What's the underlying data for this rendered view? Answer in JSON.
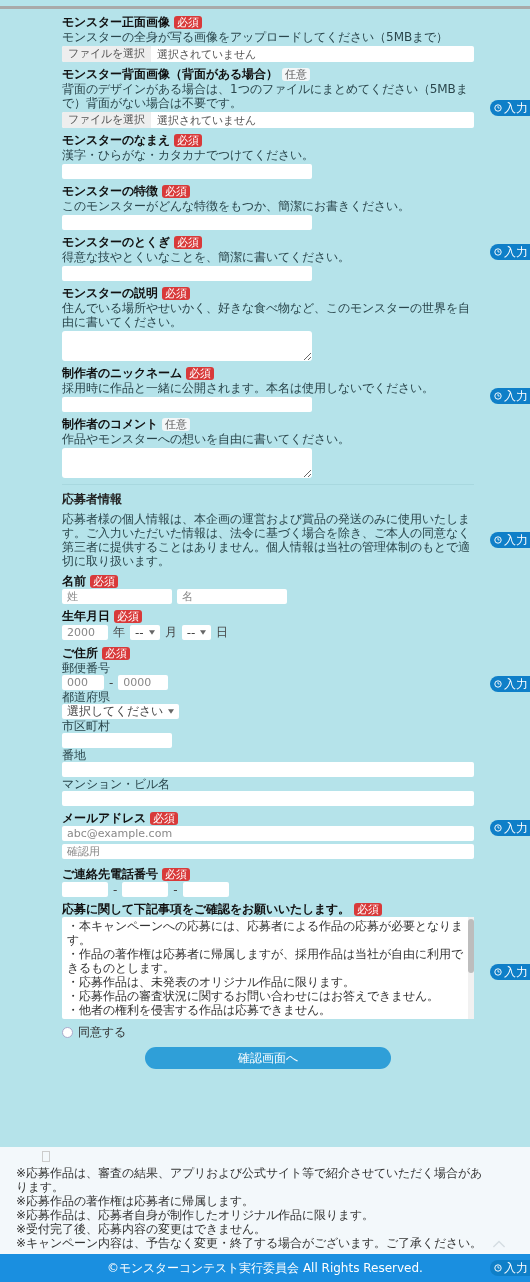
{
  "form_fields": [
    {
      "kind": "file",
      "label": "モンスター正面画像",
      "badge": "必須",
      "required": true,
      "hint": "モンスターの全身が写る画像をアップロードしてください（5MBまで）",
      "button": "ファイルを選択",
      "status": "選択されていません"
    },
    {
      "kind": "file",
      "label": "モンスター背面画像（背面がある場合）",
      "badge": "任意",
      "required": false,
      "hint": "背面のデザインがある場合は、1つのファイルにまとめてください（5MBまで）背面がない場合は不要です。",
      "button": "ファイルを選択",
      "status": "選択されていません"
    },
    {
      "kind": "text",
      "label": "モンスターのなまえ",
      "badge": "必須",
      "required": true,
      "hint": "漢字・ひらがな・カタカナでつけてください。"
    },
    {
      "kind": "text",
      "label": "モンスターの特徴",
      "badge": "必須",
      "required": true,
      "hint": "このモンスターがどんな特徴をもつか、簡潔にお書きください。"
    },
    {
      "kind": "text",
      "label": "モンスターのとくぎ",
      "badge": "必須",
      "required": true,
      "hint": "得意な技やとくいなことを、簡潔に書いてください。"
    },
    {
      "kind": "textarea",
      "label": "モンスターの説明",
      "badge": "必須",
      "required": true,
      "hint": "住んでいる場所やせいかく、好きな食べ物など、このモンスターの世界を自由に書いてください。"
    },
    {
      "kind": "text",
      "label": "制作者のニックネーム",
      "badge": "必須",
      "required": true,
      "hint": "採用時に作品と一緒に公開されます。本名は使用しないでください。"
    },
    {
      "kind": "textarea",
      "label": "制作者のコメント",
      "badge": "任意",
      "required": false,
      "hint": "作品やモンスターへの想いを自由に書いてください。"
    }
  ],
  "applicant": {
    "heading": "応募者情報",
    "text": "応募者様の個人情報は、本企画の運営および賞品の発送のみに使用いたします。ご入力いただいた情報は、法令に基づく場合を除き、ご本人の同意なく第三者に提供することはありません。個人情報は当社の管理体制のもとで適切に取り扱います。"
  },
  "applicant_fields": [
    {
      "kind": "name",
      "label": "名前",
      "badge": "必須",
      "required": true,
      "placeholders": [
        "姓",
        "名"
      ]
    },
    {
      "kind": "date",
      "label": "生年月日",
      "badge": "必須",
      "required": true,
      "year_placeholder": "2000",
      "year_unit": "年",
      "month": "--",
      "month_unit": "月",
      "day": "--",
      "day_unit": "日"
    },
    {
      "kind": "address",
      "label": "ご住所",
      "badge": "必須",
      "required": true,
      "parts": [
        {
          "kind": "zip",
          "label": "郵便番号",
          "placeholders": [
            "000",
            "0000"
          ],
          "separator": "-"
        },
        {
          "kind": "select",
          "label": "都道府県",
          "value": "選択してください"
        },
        {
          "kind": "short",
          "label": "市区町村"
        },
        {
          "kind": "long",
          "label": "番地"
        },
        {
          "kind": "long",
          "label": "マンション・ビル名"
        }
      ]
    },
    {
      "kind": "email",
      "label": "メールアドレス",
      "badge": "必須",
      "required": true,
      "placeholders": [
        "abc@example.com",
        "確認用"
      ]
    },
    {
      "kind": "phone",
      "label": "ご連絡先電話番号",
      "badge": "必須",
      "required": true,
      "separator": "-"
    },
    {
      "kind": "terms",
      "label": "応募に関して下記事項をご確認をお願いいたします。",
      "badge": "必須",
      "required": true,
      "lines": [
        "・本キャンペーンへの応募には、応募者による作品の応募が必要となります。",
        "・作品の著作権は応募者に帰属しますが、採用作品は当社が自由に利用できるものとします。",
        "・応募作品は、未発表のオリジナル作品に限ります。",
        "・応募作品の審査状況に関するお問い合わせにはお答えできません。",
        "・他者の権利を侵害する作品は応募できません。"
      ]
    }
  ],
  "agree": {
    "label": "同意する",
    "checked": false
  },
  "submit": "確認画面へ",
  "footer_notes": [
    "※応募作品は、審査の結果、アプリおよび公式サイト等で紹介させていただく場合があります。",
    "※応募作品の著作権は応募者に帰属します。",
    "※応募作品は、応募者自身が制作したオリジナル作品に限ります。",
    "※受付完了後、応募内容の変更はできません。",
    "※キャンペーン内容は、予告なく変更・終了する場合がございます。ご了承ください。"
  ],
  "float_buttons": [
    {
      "label": "入力"
    },
    {
      "label": "入力"
    },
    {
      "label": "入力"
    },
    {
      "label": "入力"
    },
    {
      "label": "入力"
    },
    {
      "label": "入力"
    },
    {
      "label": "入力"
    }
  ],
  "bottom_bar": {
    "copyright": "©モンスターコンテスト実行委員会 All Rights Reserved.",
    "button": "入力"
  }
}
